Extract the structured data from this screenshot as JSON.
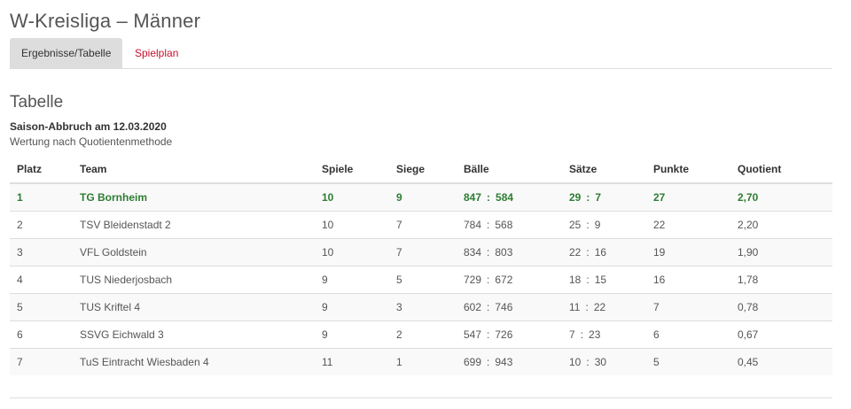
{
  "header": {
    "title": "W-Kreisliga – Männer"
  },
  "tabs": [
    {
      "label": "Ergebnisse/Tabelle",
      "active": true
    },
    {
      "label": "Spielplan",
      "active": false
    }
  ],
  "section": {
    "title": "Tabelle",
    "subtitle_bold": "Saison-Abbruch am 12.03.2020",
    "subtitle": "Wertung nach Quotientenmethode"
  },
  "colors": {
    "accent_red": "#c8102e",
    "leader_green": "#2e7d32"
  },
  "table": {
    "columns": [
      "Platz",
      "Team",
      "Spiele",
      "Siege",
      "Bälle",
      "Sätze",
      "Punkte",
      "Quotient"
    ],
    "rows": [
      {
        "platz": "1",
        "team": "TG Bornheim",
        "spiele": "10",
        "siege": "9",
        "baelle_for": "847",
        "baelle_against": "584",
        "saetze_for": "29",
        "saetze_against": "7",
        "punkte": "27",
        "quotient": "2,70"
      },
      {
        "platz": "2",
        "team": "TSV Bleidenstadt 2",
        "spiele": "10",
        "siege": "7",
        "baelle_for": "784",
        "baelle_against": "568",
        "saetze_for": "25",
        "saetze_against": "9",
        "punkte": "22",
        "quotient": "2,20"
      },
      {
        "platz": "3",
        "team": "VFL Goldstein",
        "spiele": "10",
        "siege": "7",
        "baelle_for": "834",
        "baelle_against": "803",
        "saetze_for": "22",
        "saetze_against": "16",
        "punkte": "19",
        "quotient": "1,90"
      },
      {
        "platz": "4",
        "team": "TUS Niederjosbach",
        "spiele": "9",
        "siege": "5",
        "baelle_for": "729",
        "baelle_against": "672",
        "saetze_for": "18",
        "saetze_against": "15",
        "punkte": "16",
        "quotient": "1,78"
      },
      {
        "platz": "5",
        "team": "TUS Kriftel 4",
        "spiele": "9",
        "siege": "3",
        "baelle_for": "602",
        "baelle_against": "746",
        "saetze_for": "11",
        "saetze_against": "22",
        "punkte": "7",
        "quotient": "0,78"
      },
      {
        "platz": "6",
        "team": "SSVG Eichwald 3",
        "spiele": "9",
        "siege": "2",
        "baelle_for": "547",
        "baelle_against": "726",
        "saetze_for": "7",
        "saetze_against": "23",
        "punkte": "6",
        "quotient": "0,67"
      },
      {
        "platz": "7",
        "team": "TuS Eintracht Wiesbaden 4",
        "spiele": "11",
        "siege": "1",
        "baelle_for": "699",
        "baelle_against": "943",
        "saetze_for": "10",
        "saetze_against": "30",
        "punkte": "5",
        "quotient": "0,45"
      }
    ]
  }
}
